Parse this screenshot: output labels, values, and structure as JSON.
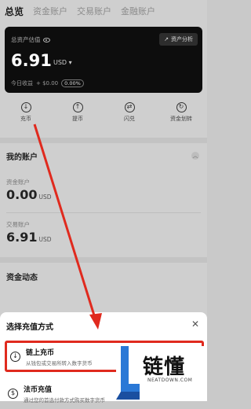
{
  "tabs": [
    "总览",
    "资金账户",
    "交易账户",
    "金融账户"
  ],
  "card": {
    "label": "总资产估值",
    "asset_button": "资产分析",
    "amount": "6.91",
    "unit": "USD",
    "today_label": "今日收益",
    "today_value": "+ $0.00",
    "today_pct": "0.00%"
  },
  "actions": [
    {
      "label": "充币",
      "icon": "deposit-icon"
    },
    {
      "label": "提币",
      "icon": "withdraw-icon"
    },
    {
      "label": "闪兑",
      "icon": "swap-icon"
    },
    {
      "label": "资金划转",
      "icon": "transfer-icon"
    }
  ],
  "my_accounts": {
    "title": "我的账户",
    "funding": {
      "name": "资金账户",
      "value": "0.00",
      "unit": "USD"
    },
    "trading": {
      "name": "交易账户",
      "value": "6.91",
      "unit": "USD"
    }
  },
  "activity_title": "资金动态",
  "sheet": {
    "title": "选择充值方式",
    "options": [
      {
        "title": "链上充币",
        "desc": "从钱包或交易所转入数字货币"
      },
      {
        "title": "法币充值",
        "desc": "通过您的首选付款方式购买数字货币"
      }
    ]
  },
  "watermark": {
    "text": "链懂",
    "url": "NEATDOWN.COM"
  },
  "colors": {
    "highlight": "#e02a1e",
    "card_bg": "#0d0d0d"
  }
}
